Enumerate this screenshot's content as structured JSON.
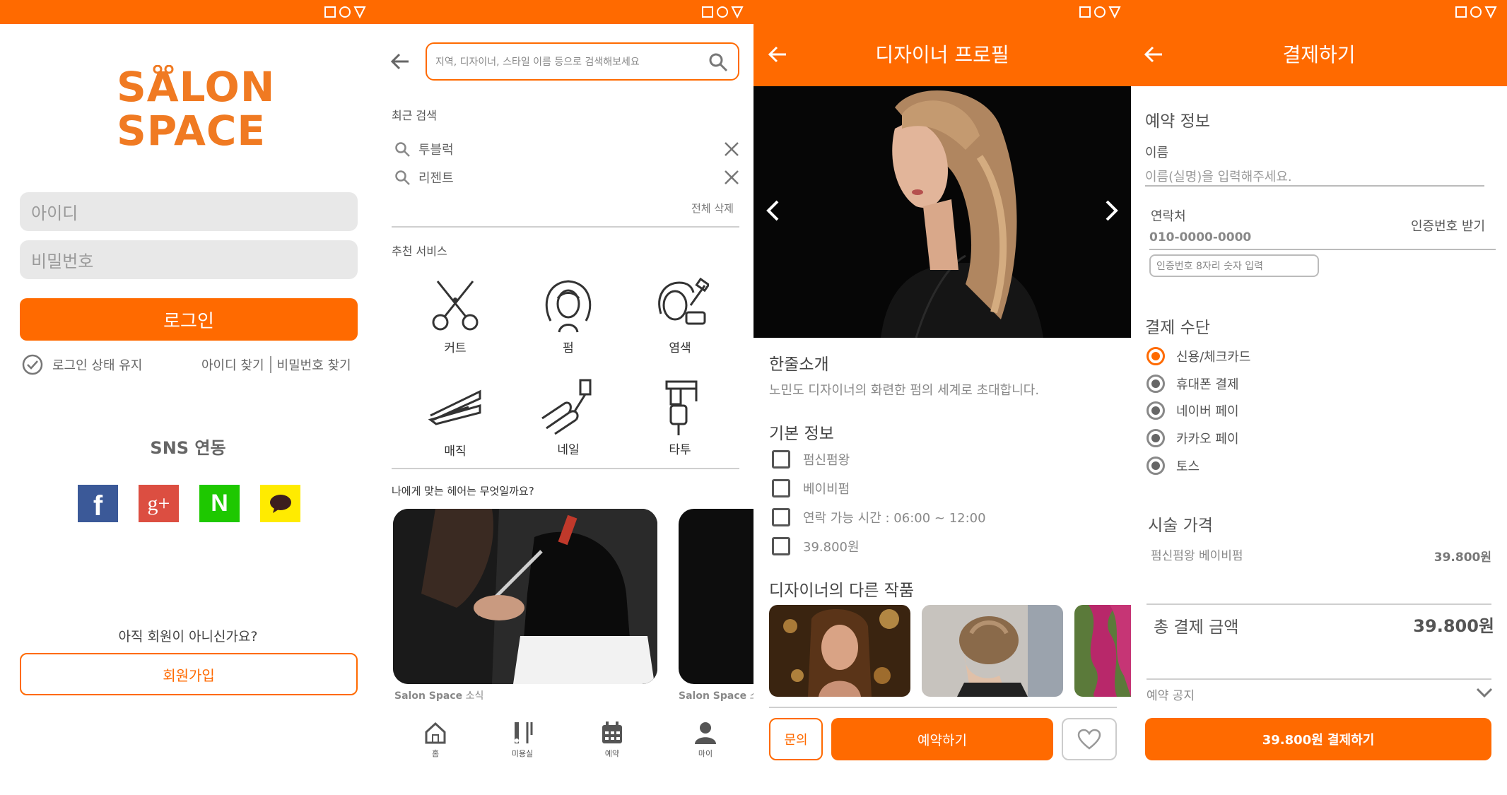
{
  "login": {
    "logo_line1": "SALON",
    "logo_line2": "SPACE",
    "id_placeholder": "아이디",
    "pw_placeholder": "비밀번호",
    "login_button": "로그인",
    "keep_login": "로그인 상태 유지",
    "find_id": "아이디 찾기",
    "find_pw": "비밀번호 찾기",
    "sns_title": "SNS 연동",
    "not_member": "아직 회원이 아니신가요?",
    "signup_button": "회원가입"
  },
  "search": {
    "placeholder": "지역, 디자이너, 스타일 이름 등으로 검색해보세요",
    "recent_title": "최근 검색",
    "recent_items": [
      "투블럭",
      "리젠트"
    ],
    "clear_all": "전체 삭제",
    "recommend_title": "추천 서비스",
    "services": [
      "커트",
      "펌",
      "염색",
      "매직",
      "네일",
      "타투"
    ],
    "hair_question": "나에게 맞는 헤어는 무엇일까요?",
    "news_brand": "Salon Space",
    "news_suffix": "소식",
    "nav": [
      "홈",
      "미용실",
      "예약",
      "마이"
    ]
  },
  "designer": {
    "title": "디자이너 프로필",
    "intro_title": "한줄소개",
    "intro_text": "노민도 디자이너의 화련한 펌의 세계로 초대합니다.",
    "basic_title": "기본 정보",
    "basic_items": [
      "펌신펌왕",
      "베이비펌",
      "연락 가능 시간 : 06:00 ~ 12:00",
      "39.800원"
    ],
    "works_title": "디자이너의 다른 작품",
    "inquiry_button": "문의",
    "reserve_button": "예약하기"
  },
  "payment": {
    "title": "결제하기",
    "reservation_title": "예약 정보",
    "name_label": "이름",
    "name_placeholder": "이름(실명)을 입력해주세요.",
    "contact_label": "연락처",
    "verify_link": "인증번호 받기",
    "phone_value": "010-0000-0000",
    "code_placeholder": "인증번호 8자리 숫자 입력",
    "method_title": "결제 수단",
    "methods": [
      "신용/체크카드",
      "휴대폰 결제",
      "네이버 페이",
      "카카오 페이",
      "토스"
    ],
    "price_title": "시술 가격",
    "price_item": "펌신펌왕 베이비펌",
    "price_value": "39.800원",
    "total_label": "총 결제 금액",
    "total_value": "39.800원",
    "notice_label": "예약 공지",
    "pay_button": "39.800원 결제하기"
  },
  "colors": {
    "accent": "#ff6a00"
  }
}
